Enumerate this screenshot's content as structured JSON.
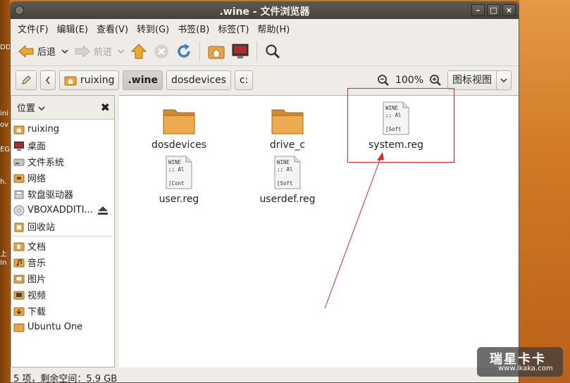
{
  "window": {
    "title": ".wine - 文件浏览器"
  },
  "menu": [
    "文件(F)",
    "编辑(E)",
    "查看(V)",
    "转到(G)",
    "书签(B)",
    "标签(T)",
    "帮助(H)"
  ],
  "toolbar": {
    "back": "后退",
    "forward": "前进"
  },
  "location": {
    "crumbs": [
      "ruixing",
      ".wine",
      "dosdevices",
      "c:"
    ],
    "active": ".wine",
    "zoom": "100%",
    "view_mode": "图标视图"
  },
  "sidebar": {
    "header": "位置",
    "places": [
      {
        "label": "ruixing",
        "icon": "home-folder-icon"
      },
      {
        "label": "桌面",
        "icon": "desktop-icon"
      },
      {
        "label": "文件系统",
        "icon": "filesystem-icon"
      },
      {
        "label": "网络",
        "icon": "network-icon"
      },
      {
        "label": "软盘驱动器",
        "icon": "floppy-icon"
      },
      {
        "label": "VBOXADDITI...",
        "icon": "cdrom-icon"
      },
      {
        "label": "回收站",
        "icon": "trash-icon"
      }
    ],
    "bookmarks": [
      {
        "label": "文档",
        "icon": "documents-folder-icon"
      },
      {
        "label": "音乐",
        "icon": "music-folder-icon"
      },
      {
        "label": "图片",
        "icon": "pictures-folder-icon"
      },
      {
        "label": "视频",
        "icon": "videos-folder-icon"
      },
      {
        "label": "下载",
        "icon": "downloads-folder-icon"
      },
      {
        "label": "Ubuntu One",
        "icon": "folder-icon"
      }
    ]
  },
  "files": [
    {
      "name": "dosdevices",
      "type": "folder"
    },
    {
      "name": "drive_c",
      "type": "folder"
    },
    {
      "name": "system.reg",
      "type": "reg",
      "preview": [
        "WINE",
        ";; Al",
        "[Soft"
      ]
    },
    {
      "name": "user.reg",
      "type": "reg",
      "preview": [
        "WINE",
        ";; Al",
        "[Cont"
      ]
    },
    {
      "name": "userdef.reg",
      "type": "reg",
      "preview": [
        "WINE",
        ";; Al",
        "[Soft"
      ]
    }
  ],
  "status": "5 项，剩余空间：5.9 GB",
  "desktop_fragments": [
    "DD",
    "ini",
    "ov",
    "EG",
    "h.",
    "上",
    "In"
  ],
  "watermark": {
    "line1": "瑞星卡卡",
    "line2": "www.ikaka.com"
  },
  "colors": {
    "annotation": "#d42a2a",
    "folder": "#e8a447"
  }
}
